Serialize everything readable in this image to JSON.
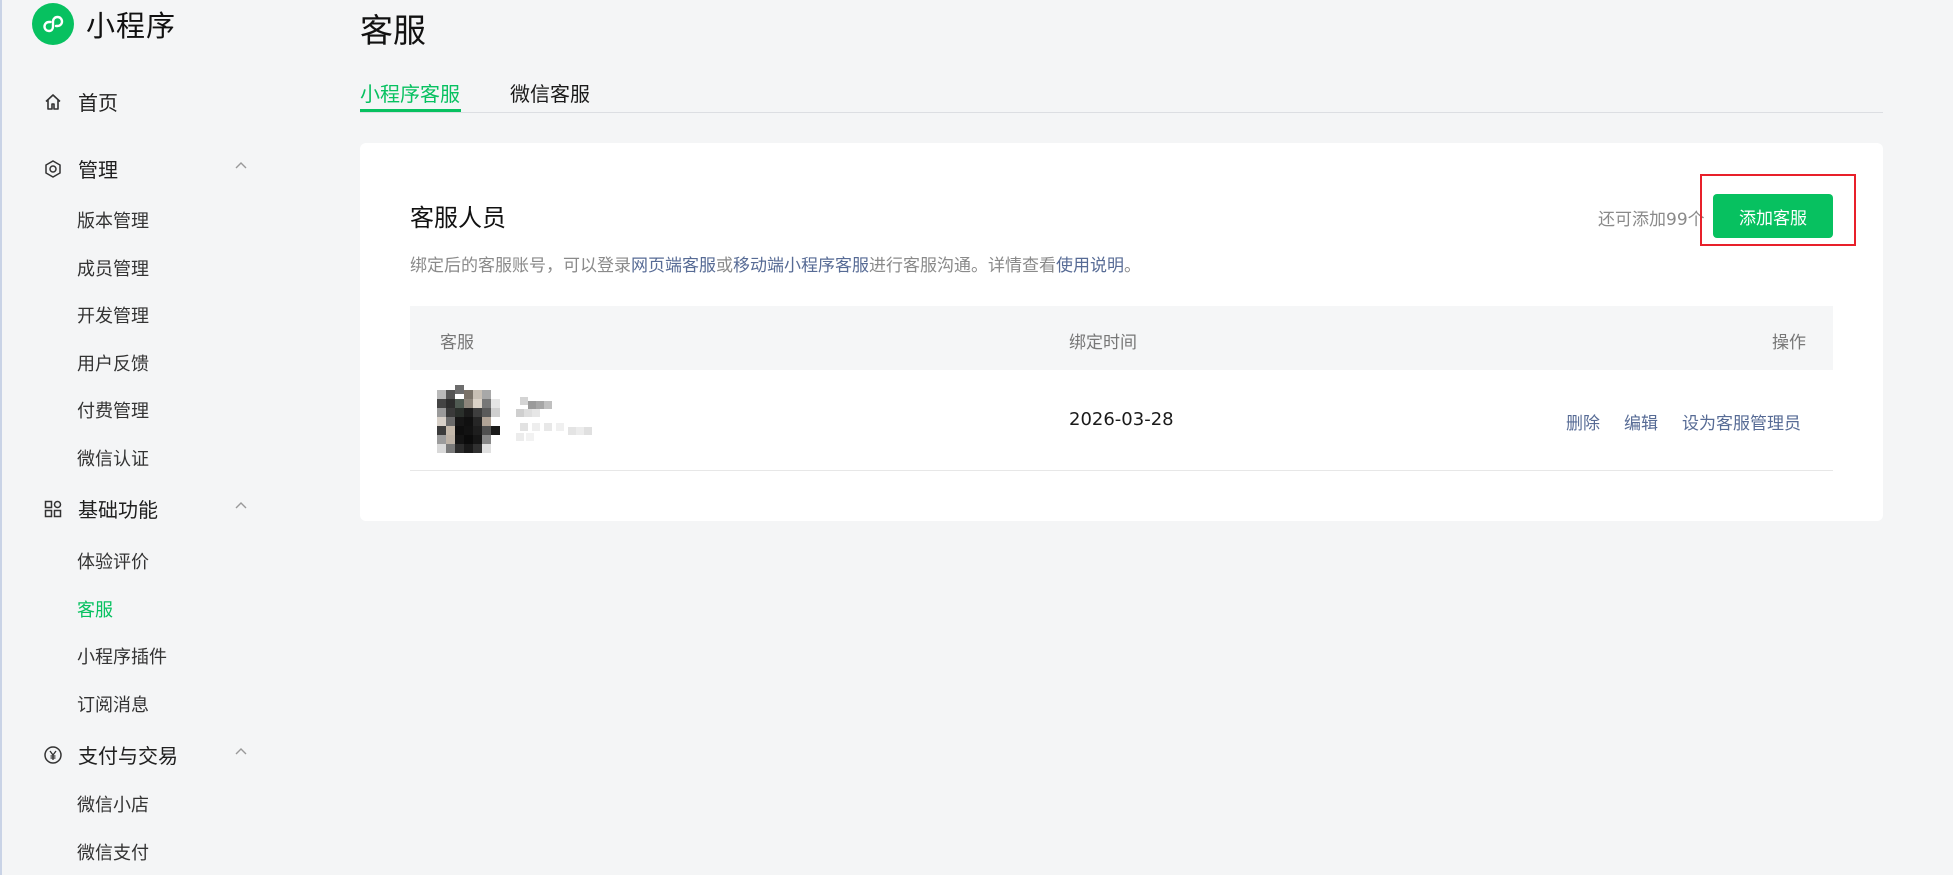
{
  "app": {
    "name": "小程序"
  },
  "sidebar": {
    "home": "首页",
    "manage": {
      "label": "管理",
      "items": [
        "版本管理",
        "成员管理",
        "开发管理",
        "用户反馈",
        "付费管理",
        "微信认证"
      ]
    },
    "basic": {
      "label": "基础功能",
      "items": [
        "体验评价",
        "客服",
        "小程序插件",
        "订阅消息"
      ],
      "active": "客服"
    },
    "pay": {
      "label": "支付与交易",
      "items": [
        "微信小店",
        "微信支付"
      ]
    }
  },
  "page": {
    "title": "客服",
    "tabs": [
      {
        "label": "小程序客服",
        "active": true
      },
      {
        "label": "微信客服",
        "active": false
      }
    ]
  },
  "card": {
    "title": "客服人员",
    "desc": {
      "t1": "绑定后的客服账号，可以登录",
      "l1": "网页端客服",
      "t2": "或",
      "l2": "移动端小程序客服",
      "t3": "进行客服沟通。详情查看",
      "l3": "使用说明",
      "t4": "。"
    },
    "quota": "还可添加99个",
    "add_button": "添加客服"
  },
  "table": {
    "headers": {
      "agent": "客服",
      "bind_time": "绑定时间",
      "actions": "操作"
    },
    "rows": [
      {
        "date": "2026-03-28",
        "actions": [
          "删除",
          "编辑",
          "设为客服管理员"
        ]
      }
    ]
  },
  "colors": {
    "brand": "#07c160",
    "link": "#576b95",
    "highlight": "#e8202a"
  }
}
